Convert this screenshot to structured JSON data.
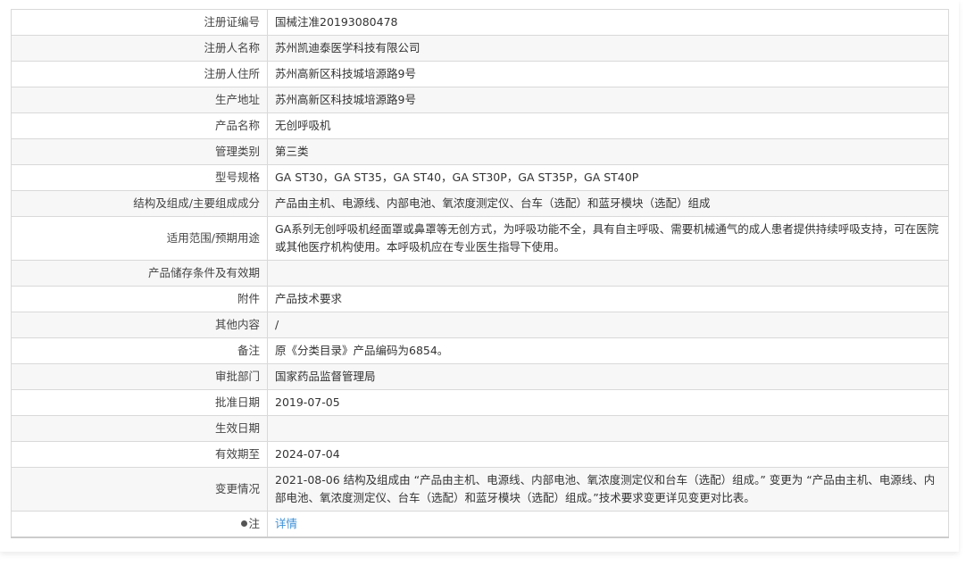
{
  "rows": [
    {
      "label": "注册证编号",
      "value": "国械注准20193080478"
    },
    {
      "label": "注册人名称",
      "value": "苏州凯迪泰医学科技有限公司"
    },
    {
      "label": "注册人住所",
      "value": "苏州高新区科技城培源路9号"
    },
    {
      "label": "生产地址",
      "value": "苏州高新区科技城培源路9号"
    },
    {
      "label": "产品名称",
      "value": "无创呼吸机"
    },
    {
      "label": "管理类别",
      "value": "第三类"
    },
    {
      "label": "型号规格",
      "value": "GA ST30，GA ST35，GA ST40，GA ST30P，GA ST35P，GA ST40P"
    },
    {
      "label": "结构及组成/主要组成成分",
      "value": "产品由主机、电源线、内部电池、氧浓度测定仪、台车（选配）和蓝牙模块（选配）组成"
    },
    {
      "label": "适用范围/预期用途",
      "value": "GA系列无创呼吸机经面罩或鼻罩等无创方式，为呼吸功能不全，具有自主呼吸、需要机械通气的成人患者提供持续呼吸支持，可在医院或其他医疗机构使用。本呼吸机应在专业医生指导下使用。"
    },
    {
      "label": "产品储存条件及有效期",
      "value": ""
    },
    {
      "label": "附件",
      "value": "产品技术要求"
    },
    {
      "label": "其他内容",
      "value": "/"
    },
    {
      "label": "备注",
      "value": "原《分类目录》产品编码为6854。"
    },
    {
      "label": "审批部门",
      "value": "国家药品监督管理局"
    },
    {
      "label": "批准日期",
      "value": "2019-07-05"
    },
    {
      "label": "生效日期",
      "value": ""
    },
    {
      "label": "有效期至",
      "value": "2024-07-04"
    },
    {
      "label": "变更情况",
      "value": "2021-08-06 结构及组成由 “产品由主机、电源线、内部电池、氧浓度测定仪和台车（选配）组成。” 变更为 “产品由主机、电源线、内部电池、氧浓度测定仪、台车（选配）和蓝牙模块（选配）组成。”技术要求变更详见变更对比表。"
    }
  ],
  "note": {
    "label": "注",
    "link": "详情"
  }
}
